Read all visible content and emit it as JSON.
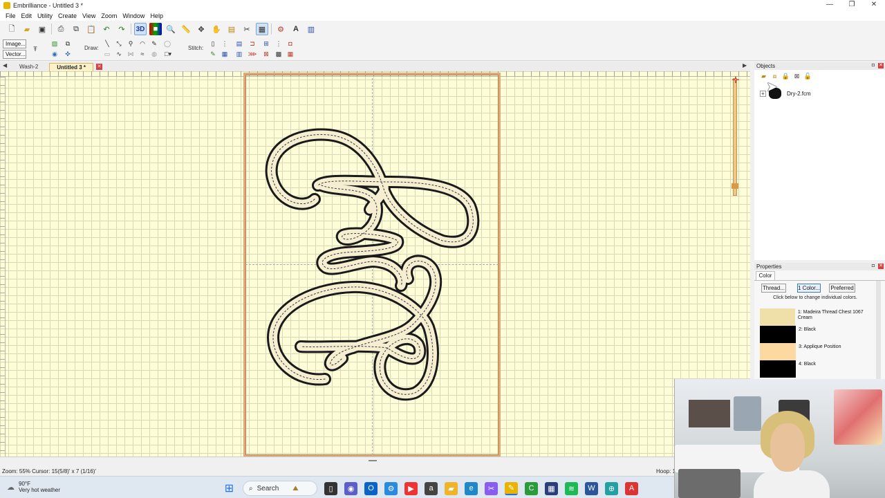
{
  "window": {
    "title": "Embrilliance - Untitled 3 *",
    "controls": [
      "—",
      "❐",
      "✕"
    ]
  },
  "menu": [
    "File",
    "Edit",
    "Utility",
    "Create",
    "View",
    "Zoom",
    "Window",
    "Help"
  ],
  "toolbar": {
    "mode3d": "3D",
    "image_label": "Image...",
    "vector_label": "Vector...",
    "draw_label": "Draw:",
    "stitch_label": "Stitch:"
  },
  "tabs": [
    {
      "label": "Wash-2",
      "active": false
    },
    {
      "label": "Untitled 3 *",
      "active": true
    }
  ],
  "objects_panel": {
    "title": "Objects",
    "item_name": "Dry-2.fcm"
  },
  "properties_panel": {
    "title": "Properties",
    "tab": "Color",
    "buttons": [
      "Thread...",
      "1 Color...",
      "Preferred"
    ],
    "hint": "Click below to change individual colors.",
    "colors": [
      {
        "label": "1: Madeira Thread Chest 1067 Cream",
        "hex": "#efe0a9"
      },
      {
        "label": "2: Black",
        "hex": "#000000"
      },
      {
        "label": "3: Applique Position",
        "hex": "#fcd9a0"
      },
      {
        "label": "4: Black",
        "hex": "#000000"
      }
    ]
  },
  "status": {
    "left": "Zoom: 55%  Cursor: 15(5/8)' x 7 (1/16)'",
    "right": "Hoop: 1"
  },
  "taskbar": {
    "weather_temp": "90°F",
    "weather_desc": "Very hot weather",
    "search_placeholder": "Search"
  },
  "colors": {
    "canvas": "#fdfdd8",
    "hoop": "#e0a979",
    "stitch": "#1a1a1a"
  }
}
